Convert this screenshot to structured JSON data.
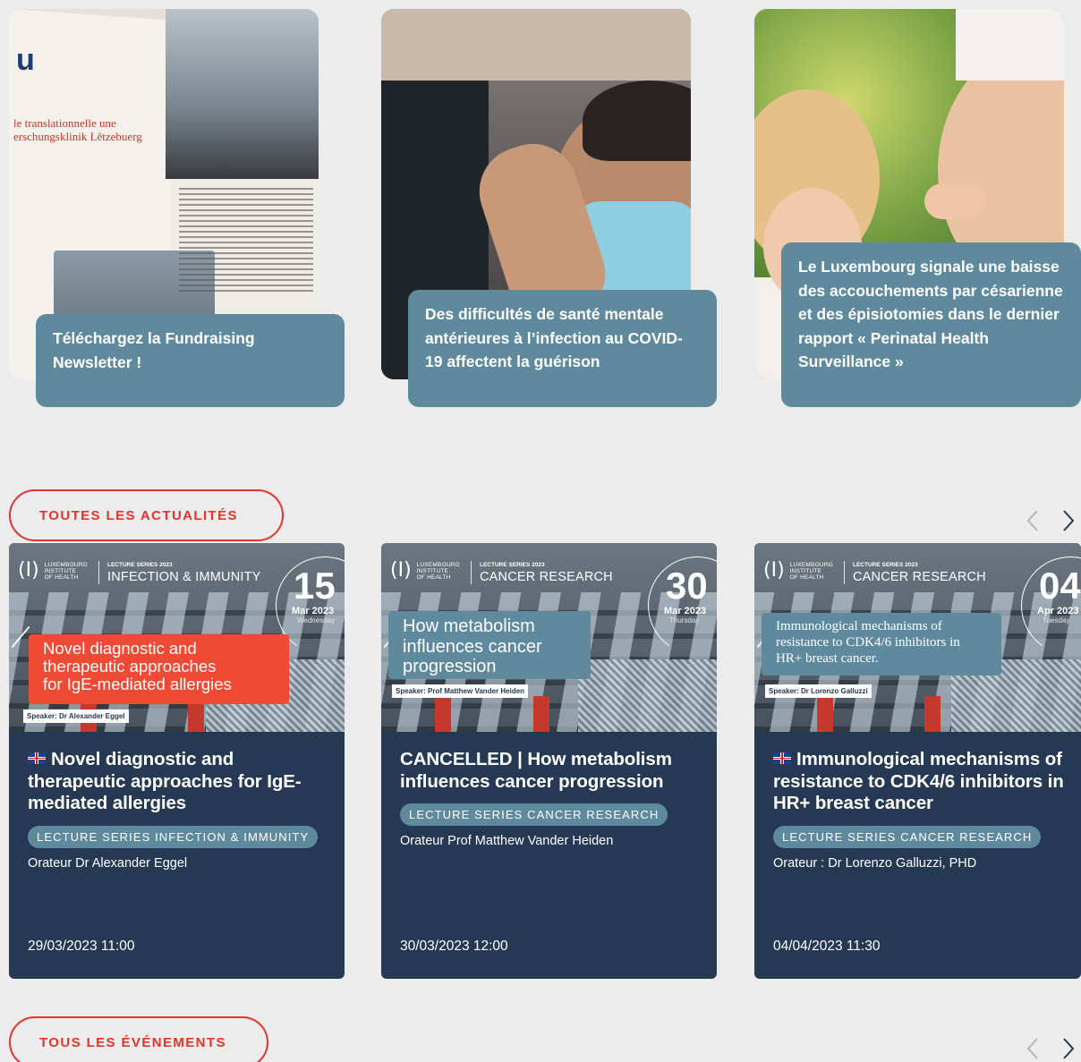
{
  "news": [
    {
      "caption": "Téléchargez la Fundraising Newsletter !",
      "image": "magazine-photo",
      "magazine_heading": "u",
      "magazine_subtitle": "le translationnelle une\nerschungsklinik Lëtzebuerg"
    },
    {
      "caption": "Des difficultés de santé mentale antérieures à l’infection au COVID-19 affectent la guérison",
      "image": "man-with-mask-photo"
    },
    {
      "caption": "Le Luxembourg signale une baisse des accouchements par césarienne et des épisiotomies dans le dernier rapport « Perinatal Health Surveillance »",
      "image": "child-and-pregnant-belly-photo"
    }
  ],
  "buttons": {
    "all_news": "TOUTES LES ACTUALITÉS",
    "all_events": "TOUS LES ÉVÉNEMENTS"
  },
  "arrows": {
    "prev": "chevron-left-icon",
    "next": "chevron-right-icon"
  },
  "events": [
    {
      "banner": {
        "logo_lines": [
          "LUXEMBOURG",
          "INSTITUTE",
          "OF HEALTH"
        ],
        "series_small": "LECTURE SERIES 2023",
        "series_big": "INFECTION & IMMUNITY",
        "day": "15",
        "month": "Mar 2023",
        "weekday": "Wednesday",
        "title": "Novel diagnostic and\ntherapeutic approaches\nfor IgE-mediated allergies",
        "speaker": "Speaker: Dr Alexander Eggel",
        "title_color": "#f04a35"
      },
      "flag": true,
      "title": "Novel diagnostic and therapeutic approaches for IgE-mediated allergies",
      "tag": "LECTURE SERIES INFECTION & IMMUNITY",
      "speaker": "Orateur Dr Alexander Eggel",
      "datetime": "29/03/2023 11:00"
    },
    {
      "banner": {
        "logo_lines": [
          "LUXEMBOURG",
          "INSTITUTE",
          "OF HEALTH"
        ],
        "series_small": "LECTURE SERIES 2023",
        "series_big": "CANCER RESEARCH",
        "day": "30",
        "month": "Mar 2023",
        "weekday": "Thursday",
        "title": "How metabolism\ninfluences cancer\nprogression",
        "speaker": "Speaker: Prof Matthew Vander Heiden",
        "title_color": "#5f8a9e"
      },
      "flag": false,
      "title": "CANCELLED | How metabolism influences cancer progression",
      "tag": "LECTURE SERIES CANCER RESEARCH",
      "speaker": "Orateur Prof Matthew Vander Heiden",
      "datetime": "30/03/2023 12:00"
    },
    {
      "banner": {
        "logo_lines": [
          "LUXEMBOURG",
          "INSTITUTE",
          "OF HEALTH"
        ],
        "series_small": "LECTURE SERIES 2023",
        "series_big": "CANCER RESEARCH",
        "day": "04",
        "month": "Apr 2023",
        "weekday": "Tuesday",
        "title": "Immunological mechanisms of\nresistance to CDK4/6 inhibitors in\nHR+ breast cancer.",
        "speaker": "Speaker: Dr Lorenzo Galluzzi",
        "title_color": "#5f8a9e"
      },
      "flag": true,
      "title": "Immunological mechanisms of resistance to CDK4/6 inhibitors in HR+ breast cancer",
      "tag": "LECTURE SERIES CANCER RESEARCH",
      "speaker": "Orateur : Dr Lorenzo Galluzzi, PHD",
      "datetime": "04/04/2023 11:30"
    }
  ],
  "colors": {
    "accent": "#e2342a",
    "caption_bg": "#5f8a9e",
    "card_bg": "#253953",
    "page_bg": "#ececec"
  }
}
